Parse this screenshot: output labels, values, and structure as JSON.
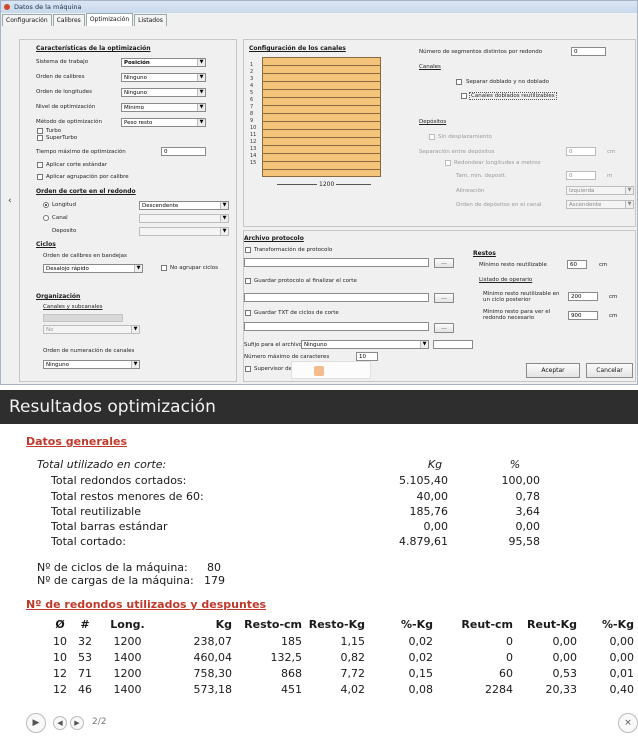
{
  "window": {
    "title": "Datos de la máquina",
    "tabs": [
      "Configuración",
      "Calibres",
      "Optimización",
      "Listados"
    ],
    "active_tab": "Optimización"
  },
  "left": {
    "opt_title": "Características de la optimización",
    "sistema_label": "Sistema de trabajo",
    "sistema_value": "Posición",
    "orden_calibres_label": "Orden de calibres",
    "orden_calibres_value": "Ninguno",
    "orden_longitudes_label": "Orden de longitudes",
    "orden_longitudes_value": "Ninguno",
    "nivel_label": "Nivel de optimización",
    "nivel_value": "Mínimo",
    "metodo_label": "Método de optimización",
    "metodo_value": "Peso resto",
    "turbo_label": "Turbo",
    "superturbo_label": "SuperTurbo",
    "tiempo_label": "Tiempo máximo de optimización",
    "tiempo_value": "0",
    "aplicar_corte_label": "Aplicar corte estándar",
    "aplicar_agrup_label": "Aplicar agrupación por calibre",
    "orden_corte_title": "Orden de corte en el redondo",
    "longitud_label": "Longitud",
    "longitud_value": "Descendente",
    "canal_label": "Canal",
    "deposito_label": "Deposito",
    "ciclos_title": "Ciclos",
    "orden_bandejas_label": "Orden de calibres en bandejas",
    "orden_bandejas_value": "Desalojo rápido",
    "no_agrupar_label": "No agrupar ciclos",
    "organizacion_title": "Organización",
    "canales_sub_label": "Canales y subcanales",
    "no_value": "No",
    "orden_num_label": "Orden de numeración de canales",
    "orden_num_value": "Ninguno"
  },
  "canales": {
    "title": "Configuración de los canales",
    "row_numbers": [
      "1",
      "2",
      "3",
      "4",
      "5",
      "6",
      "7",
      "8",
      "9",
      "10",
      "11",
      "12",
      "13",
      "14",
      "15"
    ],
    "width_label": "1200",
    "num_seg_label": "Número de segmentos distintos por redondo",
    "num_seg_value": "0",
    "canales_link": "Canales",
    "separar_label": "Separar doblado y no doblado",
    "reutil_label": "Canales doblados reutilizables",
    "depositos_link": "Depósitos",
    "sin_desp_label": "Sin desplazamiento",
    "separacion_label": "Separación entre depósitos",
    "separacion_value": "0",
    "separacion_unit": "cm",
    "redondear_label": "Redondear longitudes a metros",
    "tam_label": "Tam. min. deposit.",
    "tam_value": "0",
    "tam_unit": "m",
    "alineacion_label": "Alineación",
    "alineacion_value": "Izquierda",
    "orden_dep_label": "Orden de depósitos en el canal",
    "orden_dep_value": "Ascendente"
  },
  "archivo": {
    "title": "Archivo protocolo",
    "transf_label": "Transformación de protocolo",
    "guardar_label": "Guardar protocolo al finalizar el corte",
    "guardar_txt_label": "Guardar TXT de ciclos de corte",
    "sufijo_label": "Sufijo para el archivo",
    "sufijo_value": "Ninguno",
    "num_max_label": "Número máximo de caracteres",
    "num_max_value": "10",
    "supervisor_label": "Supervisor de",
    "browse_label": "..."
  },
  "restos": {
    "title": "Restos",
    "min_reut_label": "Mínimo resto reutilizable",
    "min_reut_value": "60",
    "min_reut_unit": "cm",
    "listado_link": "Listado de operario",
    "min_ciclo_label": "Mínimo resto reutilizable en un ciclo posterior",
    "min_ciclo_value": "200",
    "min_ciclo_unit": "cm",
    "min_ver_label": "Mínimo resto para ver el redondo necesario",
    "min_ver_value": "900",
    "min_ver_unit": "cm"
  },
  "buttons": {
    "aceptar": "Aceptar",
    "cancelar": "Cancelar"
  },
  "results": {
    "title": "Resultados optimización",
    "datos_title": "Datos generales",
    "total_util_label": "Total utilizado en corte:",
    "kg_header": "Kg",
    "pct_header": "%",
    "rows": [
      {
        "label": "Total redondos cortados:",
        "kg": "5.105,40",
        "pct": "100,00"
      },
      {
        "label": "Total restos menores de 60:",
        "kg": "40,00",
        "pct": "0,78"
      },
      {
        "label": "Total reutilizable",
        "kg": "185,76",
        "pct": "3,64"
      },
      {
        "label": "Total barras estándar",
        "kg": "0,00",
        "pct": "0,00"
      },
      {
        "label": "Total cortado:",
        "kg": "4.879,61",
        "pct": "95,58"
      }
    ],
    "ciclos_label": "Nº de ciclos de la máquina:",
    "ciclos_value": "80",
    "cargas_label": "Nº de cargas de la máquina:",
    "cargas_value": "179",
    "table_title": "Nº de redondos utilizados y despuntes",
    "table_headers": [
      "Ø",
      "#",
      "Long.",
      "Kg",
      "Resto-cm",
      "Resto-Kg",
      "%-Kg",
      "Reut-cm",
      "Reut-Kg",
      "%-Kg"
    ],
    "table_rows": [
      [
        "10",
        "32",
        "1200",
        "238,07",
        "185",
        "1,15",
        "0,02",
        "0",
        "0,00",
        "0,00"
      ],
      [
        "10",
        "53",
        "1400",
        "460,04",
        "132,5",
        "0,82",
        "0,02",
        "0",
        "0,00",
        "0,00"
      ],
      [
        "12",
        "71",
        "1200",
        "758,30",
        "868",
        "7,72",
        "0,15",
        "60",
        "0,53",
        "0,01"
      ],
      [
        "12",
        "46",
        "1400",
        "573,18",
        "451",
        "4,02",
        "0,08",
        "2284",
        "20,33",
        "0,40"
      ]
    ],
    "page_indicator": "2/2"
  }
}
